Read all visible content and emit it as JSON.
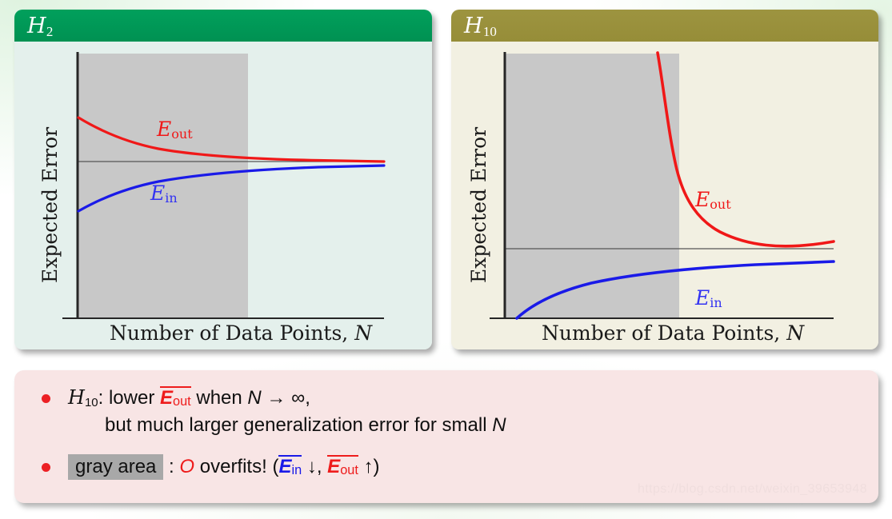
{
  "slide": {
    "watermark": "https://blog.csdn.net/weixin_39653948",
    "background_color": "#ffffff"
  },
  "panels": [
    {
      "id": "h2",
      "title": "H",
      "title_sub": "2",
      "header_color": "#009152",
      "body_color": "#e4f0ec"
    },
    {
      "id": "h10",
      "title": "H",
      "title_sub": "10",
      "header_color": "#968d38",
      "body_color": "#f2f0e2"
    }
  ],
  "chart_data": [
    {
      "type": "line",
      "id": "h2-learning-curve",
      "title": "H2",
      "xlabel": "Number of Data Points, ",
      "xlabel_symbol": "N",
      "ylabel": "Expected Error",
      "grid": false,
      "legend_position": "inline-annotations",
      "axis_ranges": {
        "x": [
          0,
          1
        ],
        "y": [
          0,
          1
        ]
      },
      "shaded_region": {
        "label": "gray area",
        "color": "#c8c8c8",
        "x_from": 0.0,
        "x_to": 0.49
      },
      "asymptote": {
        "y": 0.5,
        "color": "#555555"
      },
      "series": [
        {
          "name": "E_out",
          "label": "E",
          "label_sub": "out",
          "color": "#f01818",
          "x": [
            0.0,
            0.06,
            0.12,
            0.2,
            0.3,
            0.42,
            0.55,
            0.7,
            0.85,
            1.0
          ],
          "y": [
            0.745,
            0.7,
            0.665,
            0.63,
            0.6,
            0.578,
            0.563,
            0.553,
            0.547,
            0.543
          ]
        },
        {
          "name": "E_in",
          "label": "E",
          "label_sub": "in",
          "color": "#1a1ae8",
          "x": [
            0.0,
            0.06,
            0.12,
            0.2,
            0.3,
            0.42,
            0.55,
            0.7,
            0.85,
            1.0
          ],
          "y": [
            0.3,
            0.352,
            0.39,
            0.42,
            0.443,
            0.458,
            0.468,
            0.474,
            0.478,
            0.481
          ]
        }
      ]
    },
    {
      "type": "line",
      "id": "h10-learning-curve",
      "title": "H10",
      "xlabel": "Number of Data Points, ",
      "xlabel_symbol": "N",
      "ylabel": "Expected Error",
      "grid": false,
      "legend_position": "inline-annotations",
      "axis_ranges": {
        "x": [
          0,
          1
        ],
        "y": [
          0,
          1
        ]
      },
      "shaded_region": {
        "label": "gray area",
        "color": "#c8c8c8",
        "x_from": 0.0,
        "x_to": 0.64
      },
      "asymptote": {
        "y": 0.28,
        "color": "#555555"
      },
      "series": [
        {
          "name": "E_out",
          "label": "E",
          "label_sub": "out",
          "color": "#f01818",
          "x": [
            0.47,
            0.5,
            0.54,
            0.58,
            0.63,
            0.68,
            0.74,
            0.8,
            0.88,
            1.0
          ],
          "y": [
            1.0,
            0.92,
            0.78,
            0.655,
            0.545,
            0.47,
            0.41,
            0.372,
            0.34,
            0.318
          ]
        },
        {
          "name": "E_in",
          "label": "E",
          "label_sub": "in",
          "color": "#1a1ae8",
          "x": [
            0.06,
            0.12,
            0.2,
            0.3,
            0.42,
            0.55,
            0.7,
            0.85,
            1.0
          ],
          "y": [
            0.005,
            0.06,
            0.105,
            0.145,
            0.175,
            0.198,
            0.215,
            0.228,
            0.237
          ]
        }
      ]
    }
  ],
  "note": {
    "bullets": [
      {
        "id": "bullet-h10",
        "line1_pre": "",
        "h": "H",
        "h_sub": "10",
        "line1_a": ": lower ",
        "eout": "E",
        "eout_sub": "out",
        "line1_b": " when ",
        "n_symbol": "N",
        "line1_c": " → ∞,",
        "line2": "but much larger generalization error for small ",
        "line2_symbol": "N"
      },
      {
        "id": "bullet-gray-area",
        "highlight": "gray area",
        "mid": " : ",
        "o_symbol": "O",
        "after_o": " overfits! (",
        "ein": "E",
        "ein_sub": "in",
        "arrow_down": " ↓",
        "comma": ", ",
        "eout": "E",
        "eout_sub": "out",
        "arrow_up": " ↑",
        "close": ")"
      }
    ]
  }
}
